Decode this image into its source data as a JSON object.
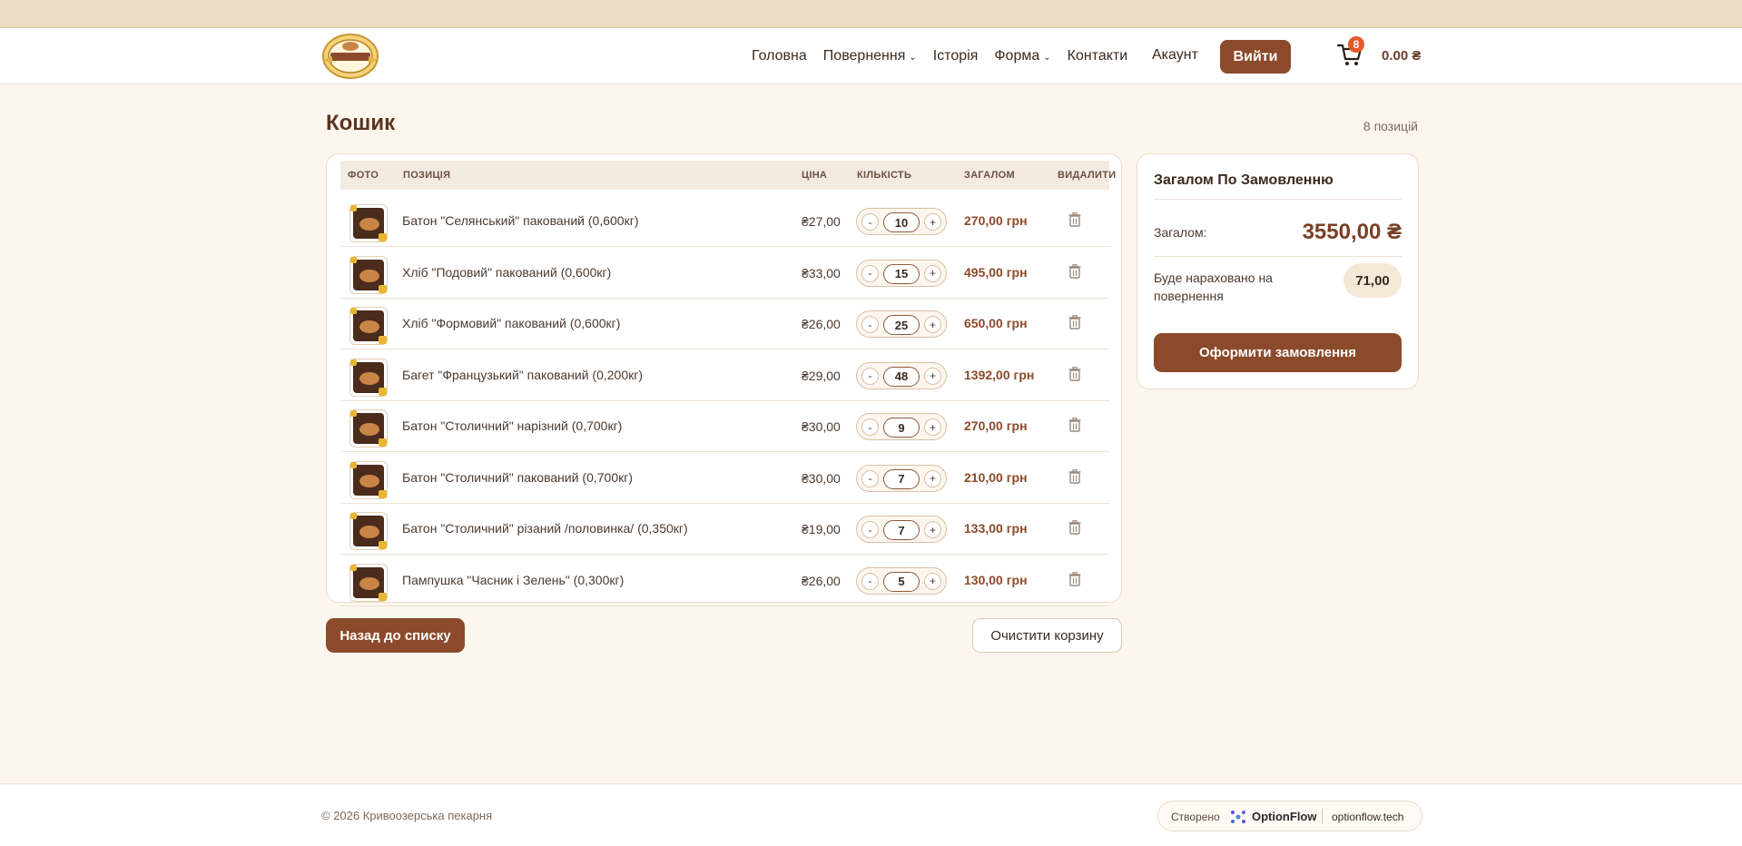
{
  "nav": {
    "items": [
      {
        "label": "Головна",
        "dropdown": false
      },
      {
        "label": "Повернення",
        "dropdown": true
      },
      {
        "label": "Історія",
        "dropdown": false
      },
      {
        "label": "Форма",
        "dropdown": true
      },
      {
        "label": "Контакти",
        "dropdown": false
      }
    ],
    "account": "Акаунт",
    "login": "Вийти",
    "cart_badge": "8",
    "cart_total": "0.00 ₴"
  },
  "page": {
    "title": "Кошик",
    "count_label": "8 позицій"
  },
  "table": {
    "headers": {
      "photo": "ФОТО",
      "item": "ПОЗИЦІЯ",
      "price": "ЦІНА",
      "qty": "КІЛЬКІСТЬ",
      "total": "ЗАГАЛОМ",
      "delete": "ВИДАЛИТИ"
    },
    "rows": [
      {
        "name": "Батон \"Селянський\" пакований (0,600кг)",
        "price": "₴27,00",
        "qty": "10",
        "total": "270,00 грн"
      },
      {
        "name": "Хліб \"Подовий\" пакований (0,600кг)",
        "price": "₴33,00",
        "qty": "15",
        "total": "495,00 грн"
      },
      {
        "name": "Хліб \"Формовий\" пакований (0,600кг)",
        "price": "₴26,00",
        "qty": "25",
        "total": "650,00 грн"
      },
      {
        "name": "Багет \"Французький\" пакований (0,200кг)",
        "price": "₴29,00",
        "qty": "48",
        "total": "1392,00 грн"
      },
      {
        "name": "Батон \"Столичний\" нарізний (0,700кг)",
        "price": "₴30,00",
        "qty": "9",
        "total": "270,00 грн"
      },
      {
        "name": "Батон \"Столичний\" пакований (0,700кг)",
        "price": "₴30,00",
        "qty": "7",
        "total": "210,00 грн"
      },
      {
        "name": "Батон \"Столичний\" різаний /половинка/ (0,350кг)",
        "price": "₴19,00",
        "qty": "7",
        "total": "133,00 грн"
      },
      {
        "name": "Пампушка \"Часник і Зелень\" (0,300кг)",
        "price": "₴26,00",
        "qty": "5",
        "total": "130,00 грн"
      }
    ],
    "minus": "-",
    "plus": "+"
  },
  "actions": {
    "back": "Назад до списку",
    "clear": "Очистити корзину"
  },
  "summary": {
    "title": "Загалом По Замовленню",
    "total_label": "Загалом:",
    "total_value": "3550,00 ₴",
    "bonus_label": "Буде нараховано на повернення",
    "bonus_value": "71,00",
    "order_button": "Оформити замовлення"
  },
  "footer": {
    "copyright": "© 2026 Кривоозерська пекарня",
    "made_by": "Створено",
    "brand": "OptionFlow",
    "site": "optionflow.tech"
  },
  "colors": {
    "accent": "#8b4a2b",
    "background": "#fdf6ee",
    "badge": "#e2592c"
  },
  "icons": {
    "logo": "bakery-logo-icon",
    "cart": "cart-icon",
    "trash": "trash-icon",
    "chevron": "chevron-down-icon",
    "brand": "optionflow-icon"
  }
}
